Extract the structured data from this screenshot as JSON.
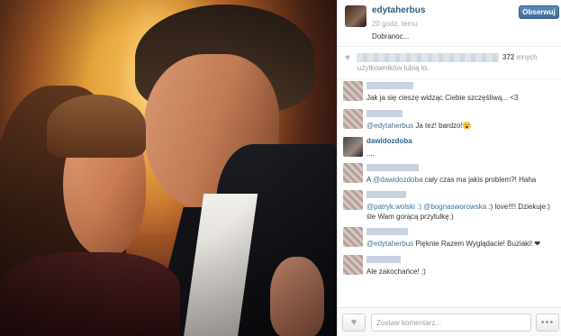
{
  "post": {
    "username": "edytaherbus",
    "time": "20 godz. temu",
    "caption": "Dobranoc...",
    "follow_label": "Obserwuj"
  },
  "likes": {
    "heart_icon": "heart-icon",
    "count": "372",
    "others": " innych",
    "tail": "użytkowników lubią to."
  },
  "comments": [
    {
      "username": "",
      "text": "Jak ja się cieszę widząc Ciebie szczęśliwą... <3",
      "mention": ""
    },
    {
      "username": "",
      "text": " Ja tez! bardzo!😮",
      "mention": "@edytaherbus"
    },
    {
      "username": "dawidozdoba",
      "text": "....",
      "mention": ""
    },
    {
      "username": "",
      "text": " cały czas ma jakis problem?! Haha",
      "mention": "@dawidozdoba",
      "prefix": "A "
    },
    {
      "username": "",
      "text": " :) love!!!! Dziekuje:) śle Wam gorącą przytulkę:)",
      "mention": "@patryk.wolski :) @bognasworowska"
    },
    {
      "username": "",
      "text": " Pięknie Razem Wyglądacie! Buziaki! ❤",
      "mention": "@edytaherbus"
    },
    {
      "username": "",
      "text": "Ale zakochańce! ;)",
      "mention": ""
    }
  ],
  "footer": {
    "input_placeholder": "Zostaw komentarz...",
    "more_label": "•••"
  }
}
